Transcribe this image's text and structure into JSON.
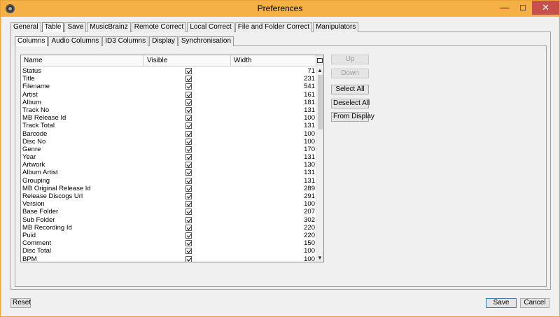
{
  "window": {
    "title": "Preferences"
  },
  "outer_tabs": [
    "General",
    "Table",
    "Save",
    "MusicBrainz",
    "Remote Correct",
    "Local Correct",
    "File and Folder Correct",
    "Manipulators"
  ],
  "outer_active": 1,
  "inner_tabs": [
    "Columns",
    "Audio Columns",
    "ID3 Columns",
    "Display",
    "Synchronisation"
  ],
  "inner_active": 0,
  "table": {
    "headers": {
      "name": "Name",
      "visible": "Visible",
      "width": "Width"
    },
    "rows": [
      {
        "name": "Status",
        "visible": true,
        "width": "71"
      },
      {
        "name": "Title",
        "visible": true,
        "width": "231"
      },
      {
        "name": "Filename",
        "visible": true,
        "width": "541"
      },
      {
        "name": "Artist",
        "visible": true,
        "width": "161"
      },
      {
        "name": "Album",
        "visible": true,
        "width": "181"
      },
      {
        "name": "Track No",
        "visible": true,
        "width": "131"
      },
      {
        "name": "MB Release Id",
        "visible": true,
        "width": "100"
      },
      {
        "name": "Track Total",
        "visible": true,
        "width": "131"
      },
      {
        "name": "Barcode",
        "visible": true,
        "width": "100"
      },
      {
        "name": "Disc No",
        "visible": true,
        "width": "100"
      },
      {
        "name": "Genre",
        "visible": true,
        "width": "170"
      },
      {
        "name": "Year",
        "visible": true,
        "width": "131"
      },
      {
        "name": "Artwork",
        "visible": true,
        "width": "130"
      },
      {
        "name": "Album Artist",
        "visible": true,
        "width": "131"
      },
      {
        "name": "Grouping",
        "visible": true,
        "width": "131"
      },
      {
        "name": "MB Original Release Id",
        "visible": true,
        "width": "289"
      },
      {
        "name": "Release Discogs Url",
        "visible": true,
        "width": "291"
      },
      {
        "name": "Version",
        "visible": true,
        "width": "100"
      },
      {
        "name": "Base Folder",
        "visible": true,
        "width": "207"
      },
      {
        "name": "Sub Folder",
        "visible": true,
        "width": "302"
      },
      {
        "name": "MB Recording Id",
        "visible": true,
        "width": "220"
      },
      {
        "name": "Puid",
        "visible": true,
        "width": "220"
      },
      {
        "name": "Comment",
        "visible": true,
        "width": "150"
      },
      {
        "name": "Disc Total",
        "visible": true,
        "width": "100"
      },
      {
        "name": "BPM",
        "visible": true,
        "width": "100"
      }
    ]
  },
  "side_buttons": {
    "up": "Up",
    "down": "Down",
    "select_all": "Select All",
    "deselect_all": "Deselect All",
    "from_display": "From Display"
  },
  "bottom_buttons": {
    "reset": "Reset",
    "save": "Save",
    "cancel": "Cancel"
  },
  "colors": {
    "titlebar": "#f5b046",
    "close": "#c7504b"
  }
}
